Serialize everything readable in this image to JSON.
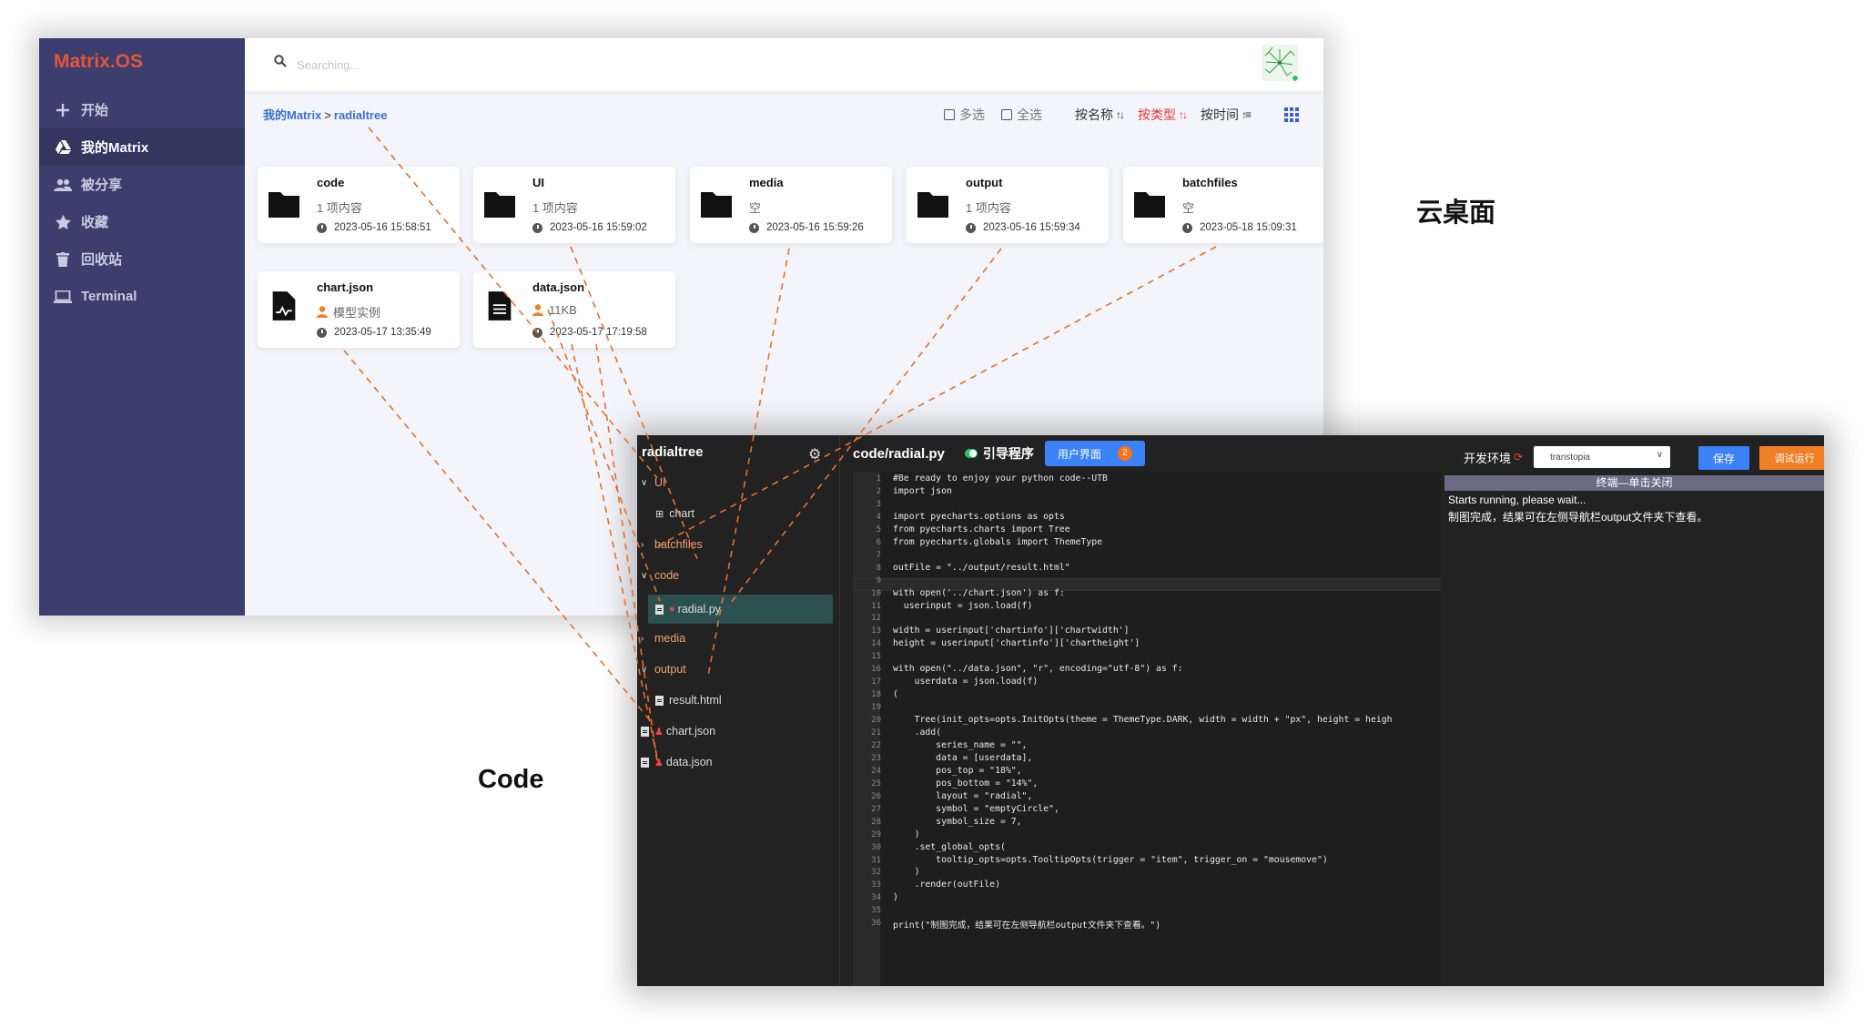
{
  "colors": {
    "sidebar": "#3c3f6e",
    "brand": "#e5533b",
    "accent_blue": "#3b82f6",
    "accent_orange": "#f07f26",
    "connector": "#e8702a"
  },
  "desktop": {
    "brand": "Matrix.OS",
    "nav": [
      {
        "label": "开始",
        "icon": "plus-icon"
      },
      {
        "label": "我的Matrix",
        "icon": "drive-icon"
      },
      {
        "label": "被分享",
        "icon": "users-icon"
      },
      {
        "label": "收藏",
        "icon": "star-icon"
      },
      {
        "label": "回收站",
        "icon": "trash-icon"
      },
      {
        "label": "Terminal",
        "icon": "laptop-icon"
      }
    ],
    "search_placeholder": "Searching...",
    "breadcrumb": {
      "root": "我的Matrix",
      "sep": ">",
      "current": "radialtree"
    },
    "toolbar": {
      "multi_select": "多选",
      "select_all": "全选",
      "sort_name": "按名称",
      "sort_type": "按类型",
      "sort_time": "按时间"
    },
    "items": [
      {
        "name": "code",
        "sub": "1 项内容",
        "date": "2023-05-16 15:58:51"
      },
      {
        "name": "UI",
        "sub": "1 项内容",
        "date": "2023-05-16 15:59:02"
      },
      {
        "name": "media",
        "sub": "空",
        "date": "2023-05-16 15:59:26"
      },
      {
        "name": "output",
        "sub": "1 项内容",
        "date": "2023-05-16 15:59:34"
      },
      {
        "name": "batchfiles",
        "sub": "空",
        "date": "2023-05-18 15:09:31"
      },
      {
        "name": "chart.json",
        "sub": "模型实例",
        "date": "2023-05-17 13:35:49"
      },
      {
        "name": "data.json",
        "sub": "11KB",
        "date": "2023-05-17 17:19:58"
      }
    ]
  },
  "labels": {
    "desktop": "云桌面",
    "code": "Code"
  },
  "code": {
    "tree_title": "radialtree",
    "tree": [
      {
        "label": "UI"
      },
      {
        "label": "chart"
      },
      {
        "label": "batchfiles"
      },
      {
        "label": "code"
      },
      {
        "label": "radial.py"
      },
      {
        "label": "media"
      },
      {
        "label": "output"
      },
      {
        "label": "result.html"
      },
      {
        "label": "chart.json"
      },
      {
        "label": "data.json"
      }
    ],
    "file_path": "code/radial.py",
    "guide_label": "引导程序",
    "ui_button": "用户界面",
    "ui_badge": "2",
    "env_label": "开发环境",
    "env_value": "transtopia",
    "save": "保存",
    "run": "调试运行",
    "lines": [
      "#Be ready to enjoy your python code--UTB",
      "import json",
      "",
      "import pyecharts.options as opts",
      "from pyecharts.charts import Tree",
      "from pyecharts.globals import ThemeType",
      "",
      "outFile = \"../output/result.html\"",
      "",
      "with open('../chart.json') as f:",
      "  userinput = json.load(f)",
      "",
      "width = userinput['chartinfo']['chartwidth']",
      "height = userinput['chartinfo']['chartheight']",
      "",
      "with open(\"../data.json\", \"r\", encoding=\"utf-8\") as f:",
      "    userdata = json.load(f)",
      "(",
      "",
      "    Tree(init_opts=opts.InitOpts(theme = ThemeType.DARK, width = width + \"px\", height = heigh",
      "    .add(",
      "        series_name = \"\",",
      "        data = [userdata],",
      "        pos_top = \"18%\",",
      "        pos_bottom = \"14%\",",
      "        layout = \"radial\",",
      "        symbol = \"emptyCircle\",",
      "        symbol_size = 7,",
      "    )",
      "    .set_global_opts(",
      "        tooltip_opts=opts.TooltipOpts(trigger = \"item\", trigger_on = \"mousemove\")",
      "    )",
      "    .render(outFile)",
      ")",
      "",
      "print(\"制图完成，结果可在左侧导航栏output文件夹下查看。\")"
    ],
    "terminal_header": "终端—单击关闭",
    "terminal_lines": [
      "Starts running, please wait...",
      "制图完成，结果可在左侧导航栏output文件夹下查看。"
    ]
  }
}
